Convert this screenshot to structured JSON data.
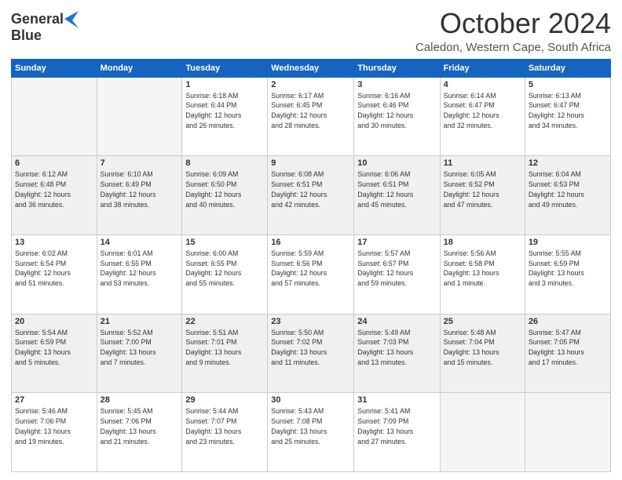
{
  "logo": {
    "line1": "General",
    "line2": "Blue"
  },
  "header": {
    "month": "October 2024",
    "location": "Caledon, Western Cape, South Africa"
  },
  "days_of_week": [
    "Sunday",
    "Monday",
    "Tuesday",
    "Wednesday",
    "Thursday",
    "Friday",
    "Saturday"
  ],
  "weeks": [
    [
      {
        "day": "",
        "info": ""
      },
      {
        "day": "",
        "info": ""
      },
      {
        "day": "1",
        "info": "Sunrise: 6:18 AM\nSunset: 6:44 PM\nDaylight: 12 hours\nand 26 minutes."
      },
      {
        "day": "2",
        "info": "Sunrise: 6:17 AM\nSunset: 6:45 PM\nDaylight: 12 hours\nand 28 minutes."
      },
      {
        "day": "3",
        "info": "Sunrise: 6:16 AM\nSunset: 6:46 PM\nDaylight: 12 hours\nand 30 minutes."
      },
      {
        "day": "4",
        "info": "Sunrise: 6:14 AM\nSunset: 6:47 PM\nDaylight: 12 hours\nand 32 minutes."
      },
      {
        "day": "5",
        "info": "Sunrise: 6:13 AM\nSunset: 6:47 PM\nDaylight: 12 hours\nand 34 minutes."
      }
    ],
    [
      {
        "day": "6",
        "info": "Sunrise: 6:12 AM\nSunset: 6:48 PM\nDaylight: 12 hours\nand 36 minutes."
      },
      {
        "day": "7",
        "info": "Sunrise: 6:10 AM\nSunset: 6:49 PM\nDaylight: 12 hours\nand 38 minutes."
      },
      {
        "day": "8",
        "info": "Sunrise: 6:09 AM\nSunset: 6:50 PM\nDaylight: 12 hours\nand 40 minutes."
      },
      {
        "day": "9",
        "info": "Sunrise: 6:08 AM\nSunset: 6:51 PM\nDaylight: 12 hours\nand 42 minutes."
      },
      {
        "day": "10",
        "info": "Sunrise: 6:06 AM\nSunset: 6:51 PM\nDaylight: 12 hours\nand 45 minutes."
      },
      {
        "day": "11",
        "info": "Sunrise: 6:05 AM\nSunset: 6:52 PM\nDaylight: 12 hours\nand 47 minutes."
      },
      {
        "day": "12",
        "info": "Sunrise: 6:04 AM\nSunset: 6:53 PM\nDaylight: 12 hours\nand 49 minutes."
      }
    ],
    [
      {
        "day": "13",
        "info": "Sunrise: 6:02 AM\nSunset: 6:54 PM\nDaylight: 12 hours\nand 51 minutes."
      },
      {
        "day": "14",
        "info": "Sunrise: 6:01 AM\nSunset: 6:55 PM\nDaylight: 12 hours\nand 53 minutes."
      },
      {
        "day": "15",
        "info": "Sunrise: 6:00 AM\nSunset: 6:55 PM\nDaylight: 12 hours\nand 55 minutes."
      },
      {
        "day": "16",
        "info": "Sunrise: 5:59 AM\nSunset: 6:56 PM\nDaylight: 12 hours\nand 57 minutes."
      },
      {
        "day": "17",
        "info": "Sunrise: 5:57 AM\nSunset: 6:57 PM\nDaylight: 12 hours\nand 59 minutes."
      },
      {
        "day": "18",
        "info": "Sunrise: 5:56 AM\nSunset: 6:58 PM\nDaylight: 13 hours\nand 1 minute."
      },
      {
        "day": "19",
        "info": "Sunrise: 5:55 AM\nSunset: 6:59 PM\nDaylight: 13 hours\nand 3 minutes."
      }
    ],
    [
      {
        "day": "20",
        "info": "Sunrise: 5:54 AM\nSunset: 6:59 PM\nDaylight: 13 hours\nand 5 minutes."
      },
      {
        "day": "21",
        "info": "Sunrise: 5:52 AM\nSunset: 7:00 PM\nDaylight: 13 hours\nand 7 minutes."
      },
      {
        "day": "22",
        "info": "Sunrise: 5:51 AM\nSunset: 7:01 PM\nDaylight: 13 hours\nand 9 minutes."
      },
      {
        "day": "23",
        "info": "Sunrise: 5:50 AM\nSunset: 7:02 PM\nDaylight: 13 hours\nand 11 minutes."
      },
      {
        "day": "24",
        "info": "Sunrise: 5:49 AM\nSunset: 7:03 PM\nDaylight: 13 hours\nand 13 minutes."
      },
      {
        "day": "25",
        "info": "Sunrise: 5:48 AM\nSunset: 7:04 PM\nDaylight: 13 hours\nand 15 minutes."
      },
      {
        "day": "26",
        "info": "Sunrise: 5:47 AM\nSunset: 7:05 PM\nDaylight: 13 hours\nand 17 minutes."
      }
    ],
    [
      {
        "day": "27",
        "info": "Sunrise: 5:46 AM\nSunset: 7:06 PM\nDaylight: 13 hours\nand 19 minutes."
      },
      {
        "day": "28",
        "info": "Sunrise: 5:45 AM\nSunset: 7:06 PM\nDaylight: 13 hours\nand 21 minutes."
      },
      {
        "day": "29",
        "info": "Sunrise: 5:44 AM\nSunset: 7:07 PM\nDaylight: 13 hours\nand 23 minutes."
      },
      {
        "day": "30",
        "info": "Sunrise: 5:43 AM\nSunset: 7:08 PM\nDaylight: 13 hours\nand 25 minutes."
      },
      {
        "day": "31",
        "info": "Sunrise: 5:41 AM\nSunset: 7:09 PM\nDaylight: 13 hours\nand 27 minutes."
      },
      {
        "day": "",
        "info": ""
      },
      {
        "day": "",
        "info": ""
      }
    ]
  ]
}
